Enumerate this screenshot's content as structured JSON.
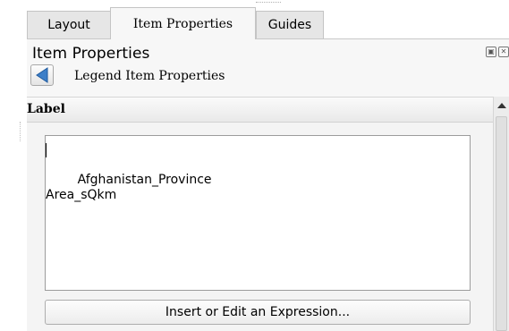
{
  "tabs": [
    {
      "label": "Layout",
      "active": false
    },
    {
      "label": "Item Properties",
      "active": true
    },
    {
      "label": "Guides",
      "active": false
    }
  ],
  "panel": {
    "title": "Item Properties",
    "float_icons": [
      "float-icon",
      "close-icon"
    ],
    "back_icon": "back-arrow-icon",
    "subtitle": "Legend Item Properties"
  },
  "label_group": {
    "header": "Label",
    "text_value": "Afghanistan_Province\nArea_sQkm",
    "expression_button": "Insert or Edit an Expression..."
  },
  "colors": {
    "panel_bg": "#f7f7f7",
    "back_arrow": "#3d7fc8",
    "tab_inactive": "#e6e6e6"
  }
}
